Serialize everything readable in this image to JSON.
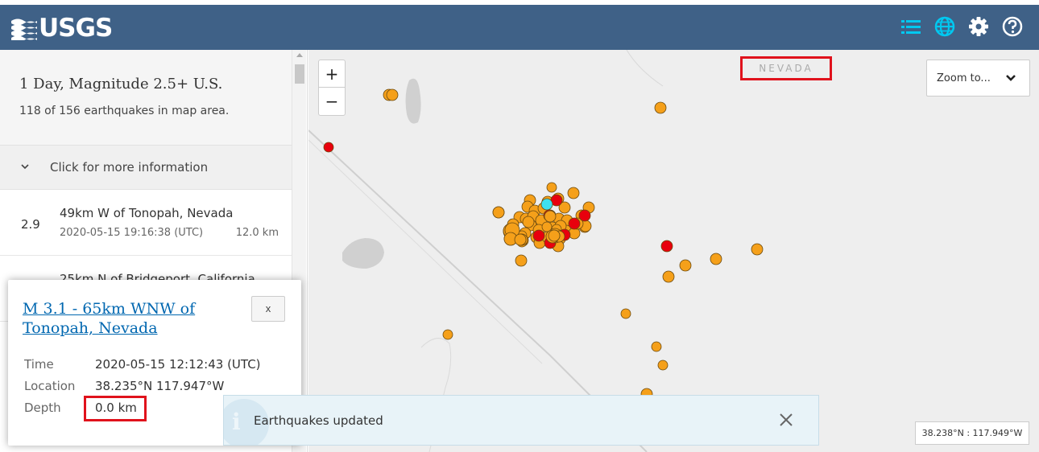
{
  "header": {
    "logo_text": "USGS",
    "icons": [
      "list-icon",
      "globe-icon",
      "gear-icon",
      "help-icon"
    ],
    "brand_color": "#3f6187",
    "active_icon_color": "#00c8f0"
  },
  "sidebar": {
    "title": "1 Day, Magnitude 2.5+ U.S.",
    "count_text": "118 of 156 earthquakes in map area.",
    "more_info_label": "Click for more information",
    "earthquakes": [
      {
        "mag": "2.9",
        "place": "49km W of Tonopah, Nevada",
        "time": "2020-05-15 19:16:38 (UTC)",
        "depth": "12.0 km"
      },
      {
        "mag": "",
        "place": "25km N of Bridgeport, California",
        "time": "",
        "depth": ""
      }
    ]
  },
  "map": {
    "state_label": "NEVADA",
    "zoom_in": "+",
    "zoom_out": "−",
    "zoom_to_label": "Zoom to...",
    "coordinate_readout": "38.238°N : 117.949°W",
    "marker_colors": {
      "past_day": "#f5a01a",
      "past_hour": "#e8000d",
      "selected": "#3fe0f0"
    }
  },
  "popup": {
    "title": "M 3.1 - 65km WNW of Tonopah, Nevada",
    "close_label": "x",
    "time_label": "Time",
    "time_value": "2020-05-15 12:12:43 (UTC)",
    "location_label": "Location",
    "location_value": "38.235°N 117.947°W",
    "depth_label": "Depth",
    "depth_value": "0.0 km"
  },
  "toast": {
    "message": "Earthquakes updated"
  }
}
